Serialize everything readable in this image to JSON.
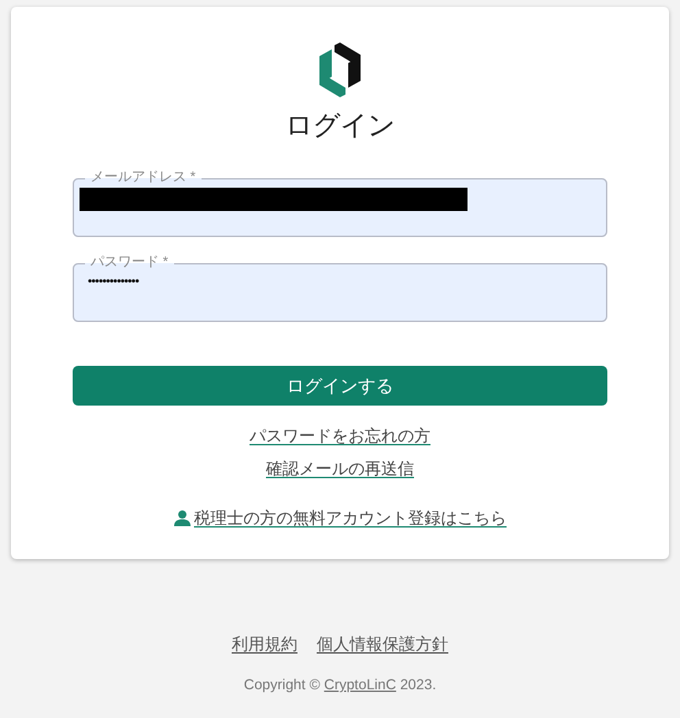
{
  "title": "ログイン",
  "fields": [
    {
      "label": "メールアドレス *",
      "redacted": true
    },
    {
      "label": "パスワード *",
      "value": "••••••••••••••",
      "redacted": false
    }
  ],
  "submit": "ログインする",
  "links": [
    {
      "text": "パスワードをお忘れの方",
      "icon": false
    },
    {
      "text": "確認メールの再送信",
      "icon": false
    },
    {
      "text": "税理士の方の無料アカウント登録はこちら",
      "icon": true
    }
  ],
  "footer": {
    "links": [
      "利用規約",
      "個人情報保護方針"
    ],
    "copyright_before": "Copyright © ",
    "copyright_link": "CryptoLinC",
    "copyright_after": " 2023."
  }
}
